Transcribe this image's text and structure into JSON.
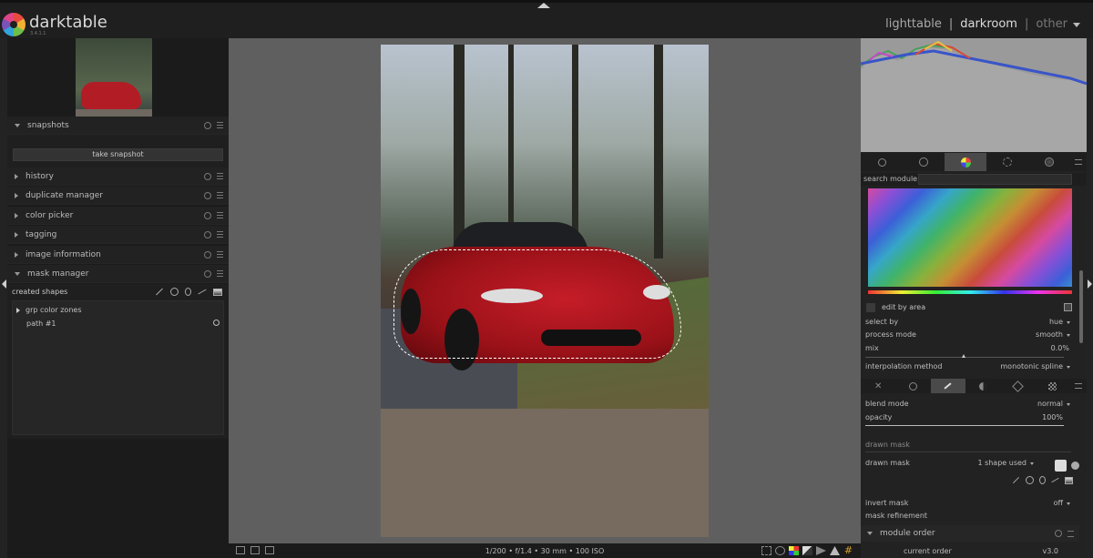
{
  "app": {
    "name": "darktable",
    "version": "3.4.1.1"
  },
  "views": {
    "lighttable": "lighttable",
    "sep1": "|",
    "darkroom": "darkroom",
    "sep2": "|",
    "other": "other"
  },
  "left_panel": {
    "modules": [
      {
        "label": "snapshots",
        "expanded": true
      },
      {
        "label": "history",
        "expanded": false
      },
      {
        "label": "duplicate manager",
        "expanded": false
      },
      {
        "label": "color picker",
        "expanded": false
      },
      {
        "label": "tagging",
        "expanded": false
      },
      {
        "label": "image information",
        "expanded": false
      },
      {
        "label": "mask manager",
        "expanded": true
      }
    ],
    "snapshot_button": "take snapshot",
    "mask_manager": {
      "created_shapes_label": "created shapes",
      "groups": [
        {
          "label": "grp color zones"
        }
      ],
      "shapes": [
        {
          "label": "path #1"
        }
      ]
    }
  },
  "status_bar": {
    "exif": "1/200 • f/1.4 • 30 mm • 100 ISO"
  },
  "right_panel": {
    "search_label": "search module",
    "search_value": "",
    "edit_by_area": "edit by area",
    "params": [
      {
        "label": "select by",
        "value": "hue",
        "dropdown": true
      },
      {
        "label": "process mode",
        "value": "smooth",
        "dropdown": true
      },
      {
        "label": "mix",
        "value": "0.0%",
        "dropdown": false
      }
    ],
    "interpolation": {
      "label": "interpolation method",
      "value": "monotonic spline"
    },
    "blend_mode": {
      "label": "blend mode",
      "value": "normal"
    },
    "opacity": {
      "label": "opacity",
      "value": "100%",
      "level": 1.0
    },
    "drawn_mask_section": "drawn mask",
    "drawn_mask": {
      "label": "drawn mask",
      "value": "1 shape used"
    },
    "invert_mask": {
      "label": "invert mask",
      "value": "off"
    },
    "mask_refinement": "mask refinement",
    "module_order": {
      "label": "module order",
      "current_label": "current order",
      "current_value": "v3.0"
    }
  },
  "colors": {
    "accent_red": "#b21d25",
    "panel_bg": "#222222",
    "canvas_bg": "#5f5f5f"
  }
}
